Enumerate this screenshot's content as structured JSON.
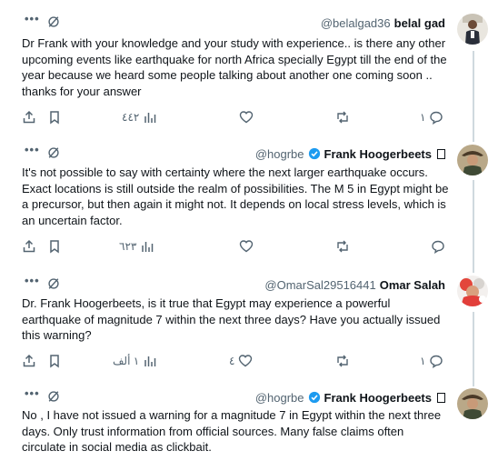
{
  "tweets": [
    {
      "display_name": "belal gad",
      "handle": "@belalgad36",
      "verified": false,
      "text": "Dr Frank with your knowledge and your study with experience.. is there any other upcoming events like earthquake for north Africa specially Egypt till the end of the year because we heard some people talking about another one coming soon .. thanks for your answer",
      "stats": {
        "views": "٤٤٢",
        "reposts": "",
        "likes": "",
        "replies": "١"
      }
    },
    {
      "display_name": "Frank Hoogerbeets",
      "handle": "@hogrbe",
      "verified": true,
      "text": "It's not possible to say with certainty where the next larger earthquake occurs. Exact locations is still outside the realm of possibilities. The M 5 in Egypt might be a precursor, but then again it might not. It depends on local stress levels, which is an uncertain factor.",
      "stats": {
        "views": "٦٢٣",
        "reposts": "",
        "likes": "",
        "replies": ""
      }
    },
    {
      "display_name": "Omar Salah",
      "handle": "@OmarSal29516441",
      "verified": false,
      "text": "Dr. Frank Hoogerbeets, is it true that Egypt may experience a powerful earthquake of magnitude 7 within the next three days? Have you actually issued this warning?",
      "stats": {
        "views": "١ ألف",
        "reposts": "",
        "likes": "٤",
        "replies": "١"
      }
    },
    {
      "display_name": "Frank Hoogerbeets",
      "handle": "@hogrbe",
      "verified": true,
      "text": "No , I have not issued a warning for a magnitude 7 in Egypt within the next three days. Only trust information from official sources. Many false claims often circulate in social media as clickbait."
    }
  ],
  "icons": [
    "more-icon",
    "grok-icon",
    "verified-badge-icon",
    "share-icon",
    "bookmark-icon",
    "views-icon",
    "like-icon",
    "repost-icon",
    "reply-icon"
  ],
  "colors": {
    "text": "#0f1419",
    "secondary": "#536471",
    "verified": "#1d9bf0",
    "thread_line": "#cfd9de"
  }
}
